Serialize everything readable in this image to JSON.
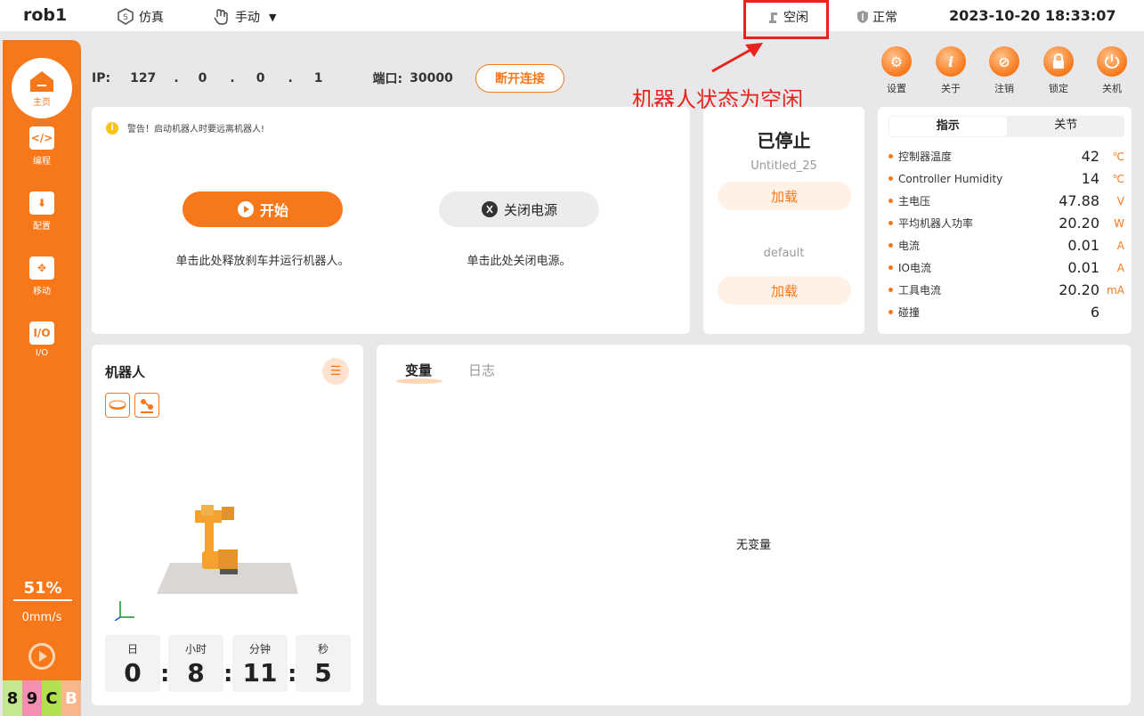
{
  "topbar": {
    "app_name": "rob1",
    "mode_sim": "仿真",
    "mode_manual": "手动",
    "status": "空闲",
    "safety": "正常",
    "datetime": "2023-10-20 18:33:07"
  },
  "sidebar": {
    "items": [
      {
        "label": "主页",
        "icon": "home-icon"
      },
      {
        "label": "编程",
        "icon": "code-icon"
      },
      {
        "label": "配置",
        "icon": "config-icon"
      },
      {
        "label": "移动",
        "icon": "move-icon"
      },
      {
        "label": "I/O",
        "icon": "io-icon"
      }
    ],
    "io_glyph": "I/O",
    "speed_percent": "51%",
    "speed_mm": "0mm/s",
    "codes": [
      {
        "text": "8",
        "color": "#c3e88d"
      },
      {
        "text": "9",
        "color": "#f48fb1"
      },
      {
        "text": "C",
        "color": "#b2e051"
      },
      {
        "text": "B",
        "color": "#f7b68c"
      }
    ]
  },
  "connection": {
    "ip_label": "IP:",
    "ip": [
      "127",
      ".",
      "0",
      ".",
      "0",
      ".",
      "1"
    ],
    "port_label": "端口:",
    "port": "30000",
    "disconnect": "断开连接"
  },
  "annotation": "机器人状态为空闲",
  "tools": [
    {
      "label": "设置",
      "icon": "settings-icon",
      "glyph": "⚙"
    },
    {
      "label": "关于",
      "icon": "info-icon",
      "glyph": "i"
    },
    {
      "label": "注销",
      "icon": "logout-icon",
      "glyph": "⊘"
    },
    {
      "label": "锁定",
      "icon": "lock-icon",
      "glyph": "🔒"
    },
    {
      "label": "关机",
      "icon": "power-icon",
      "glyph": "⏻"
    }
  ],
  "control": {
    "warning": "警告！启动机器人时要远离机器人!",
    "start": "开始",
    "power_off": "关闭电源",
    "start_hint": "单击此处释放刹车并运行机器人。",
    "power_hint": "单击此处关闭电源。"
  },
  "program": {
    "state": "已停止",
    "name1": "Untitled_25",
    "load1": "加载",
    "name2": "default",
    "load2": "加载"
  },
  "indicators": {
    "tab_active": "指示",
    "tab_inactive": "关节",
    "rows": [
      {
        "label": "控制器温度",
        "value": "42",
        "unit": "℃"
      },
      {
        "label": "Controller Humidity",
        "value": "14",
        "unit": "℃"
      },
      {
        "label": "主电压",
        "value": "47.88",
        "unit": "V"
      },
      {
        "label": "平均机器人功率",
        "value": "20.20",
        "unit": "W"
      },
      {
        "label": "电流",
        "value": "0.01",
        "unit": "A"
      },
      {
        "label": "IO电流",
        "value": "0.01",
        "unit": "A"
      },
      {
        "label": "工具电流",
        "value": "20.20",
        "unit": "mA"
      },
      {
        "label": "碰撞",
        "value": "6",
        "unit": ""
      }
    ]
  },
  "robot": {
    "title": "机器人",
    "timer": [
      {
        "label": "日",
        "value": "0"
      },
      {
        "label": "小时",
        "value": "8"
      },
      {
        "label": "分钟",
        "value": "11"
      },
      {
        "label": "秒",
        "value": "5"
      }
    ]
  },
  "variables": {
    "tab_active": "变量",
    "tab_inactive": "日志",
    "empty": "无变量"
  }
}
